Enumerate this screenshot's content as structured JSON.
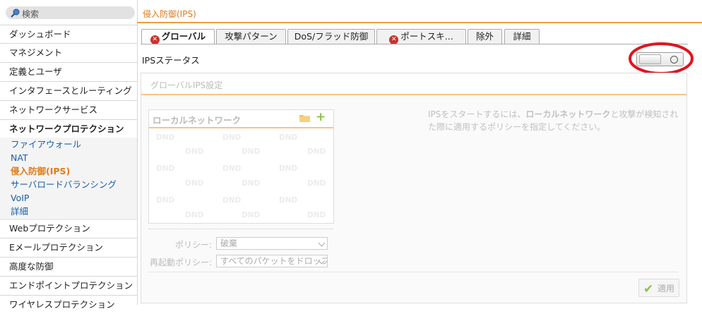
{
  "search": {
    "placeholder": "検索"
  },
  "sidebar": {
    "items_top": [
      "ダッシュボード",
      "マネジメント",
      "定義とユーザ",
      "インタフェースとルーティング",
      "ネットワークサービス"
    ],
    "open_section": "ネットワークプロテクション",
    "sub_items": [
      "ファイアウォール",
      "NAT",
      "侵入防御(IPS)",
      "サーバロードバランシング",
      "VoIP",
      "詳細"
    ],
    "active_sub": "侵入防御(IPS)",
    "items_bottom": [
      "Webプロテクション",
      "Eメールプロテクション",
      "高度な防御",
      "エンドポイントプロテクション",
      "ワイヤレスプロテクション"
    ]
  },
  "header": {
    "title": "侵入防御(IPS)"
  },
  "tabs": [
    {
      "label": "グローバル",
      "error": true,
      "active": true
    },
    {
      "label": "攻撃パターン",
      "error": false,
      "active": false
    },
    {
      "label": "DoS/フラッド防御",
      "error": false,
      "active": false
    },
    {
      "label": "ポートスキ...",
      "error": true,
      "active": false
    },
    {
      "label": "除外",
      "error": false,
      "active": false
    },
    {
      "label": "詳細",
      "error": false,
      "active": false
    }
  ],
  "status": {
    "label": "IPSステータス",
    "enabled": false
  },
  "panel": {
    "title": "グローバルIPS設定",
    "local_network_label": "ローカルネットワーク",
    "dnd_text": "DND",
    "description_pre": "IPSをスタートするには、",
    "description_bold": "ローカルネットワーク",
    "description_post": "と攻撃が検知された際に適用するポリシーを指定してください。",
    "policy_label": "ポリシー:",
    "policy_value": "破棄",
    "restart_label": "再起動ポリシー:",
    "restart_value": "すべてのパケットをドロップ",
    "apply_label": "適用"
  },
  "colors": {
    "accent": "#e07b16",
    "link": "#1a5ea8",
    "error": "#c8332d",
    "highlight": "#e0141e",
    "ok": "#8bc34a"
  }
}
